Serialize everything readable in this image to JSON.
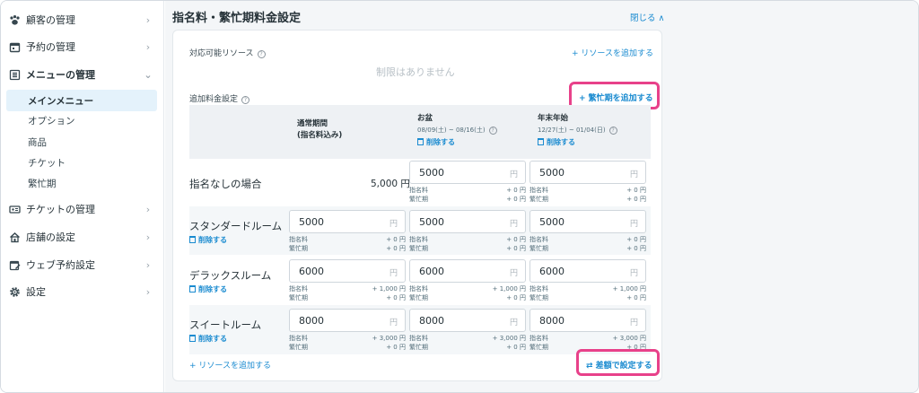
{
  "sidebar": {
    "items": [
      {
        "label": "顧客の管理",
        "icon": "paw-icon"
      },
      {
        "label": "予約の管理",
        "icon": "calendar-icon"
      },
      {
        "label": "メニューの管理",
        "icon": "menu-list-icon",
        "expanded": true
      },
      {
        "label": "チケットの管理",
        "icon": "ticket-icon"
      },
      {
        "label": "店舗の設定",
        "icon": "home-icon"
      },
      {
        "label": "ウェブ予約設定",
        "icon": "calendar-edit-icon"
      },
      {
        "label": "設定",
        "icon": "gear-icon"
      }
    ],
    "submenu": [
      {
        "label": "メインメニュー",
        "active": true
      },
      {
        "label": "オプション"
      },
      {
        "label": "商品"
      },
      {
        "label": "チケット"
      },
      {
        "label": "繁忙期"
      }
    ]
  },
  "main": {
    "title": "指名料・繁忙期料金設定",
    "close_label": "閉じる ∧",
    "resources_label": "対応可能リソース",
    "add_resource_top": "+ リソースを追加する",
    "no_limit": "制限はありません",
    "additional_label": "追加料金設定",
    "add_busy_period": "+ 繁忙期を追加する",
    "columns": {
      "normal_line1": "通常期間",
      "normal_line2": "(指名料込み)",
      "obon": "お盆",
      "obon_range": "08/09(土) ~ 08/16(土)",
      "newyear": "年末年始",
      "newyear_range": "12/27(土) ~ 01/04(日)",
      "delete": "削除する"
    },
    "labels": {
      "nomination": "指名料",
      "busy": "繁忙期",
      "yen": "円",
      "delete": "削除する"
    },
    "rows": [
      {
        "name": "指名なしの場合",
        "normal_static": "5,000 円",
        "cells": [
          {
            "value": "5000",
            "nomination": "+ 0 円",
            "busy": "+ 0 円"
          },
          {
            "value": "5000",
            "nomination": "+ 0 円",
            "busy": "+ 0 円"
          }
        ]
      },
      {
        "name": "スタンダードルーム",
        "cells": [
          {
            "value": "5000",
            "nomination": "+ 0 円",
            "busy": "+ 0 円"
          },
          {
            "value": "5000",
            "nomination": "+ 0 円",
            "busy": "+ 0 円"
          },
          {
            "value": "5000",
            "nomination": "+ 0 円",
            "busy": "+ 0 円"
          }
        ]
      },
      {
        "name": "デラックスルーム",
        "cells": [
          {
            "value": "6000",
            "nomination": "+ 1,000 円",
            "busy": "+ 0 円"
          },
          {
            "value": "6000",
            "nomination": "+ 1,000 円",
            "busy": "+ 0 円"
          },
          {
            "value": "6000",
            "nomination": "+ 1,000 円",
            "busy": "+ 0 円"
          }
        ]
      },
      {
        "name": "スイートルーム",
        "cells": [
          {
            "value": "8000",
            "nomination": "+ 3,000 円",
            "busy": "+ 0 円"
          },
          {
            "value": "8000",
            "nomination": "+ 3,000 円",
            "busy": "+ 0 円"
          },
          {
            "value": "8000",
            "nomination": "+ 3,000 円",
            "busy": "+ 0 円"
          }
        ]
      }
    ],
    "add_resource_bottom": "+ リソースを追加する",
    "set_by_diff": "⇄ 差額で設定する"
  },
  "colors": {
    "accent": "#1a8bd0",
    "highlight": "#e8418a",
    "active_bg": "#e4f2fb"
  }
}
